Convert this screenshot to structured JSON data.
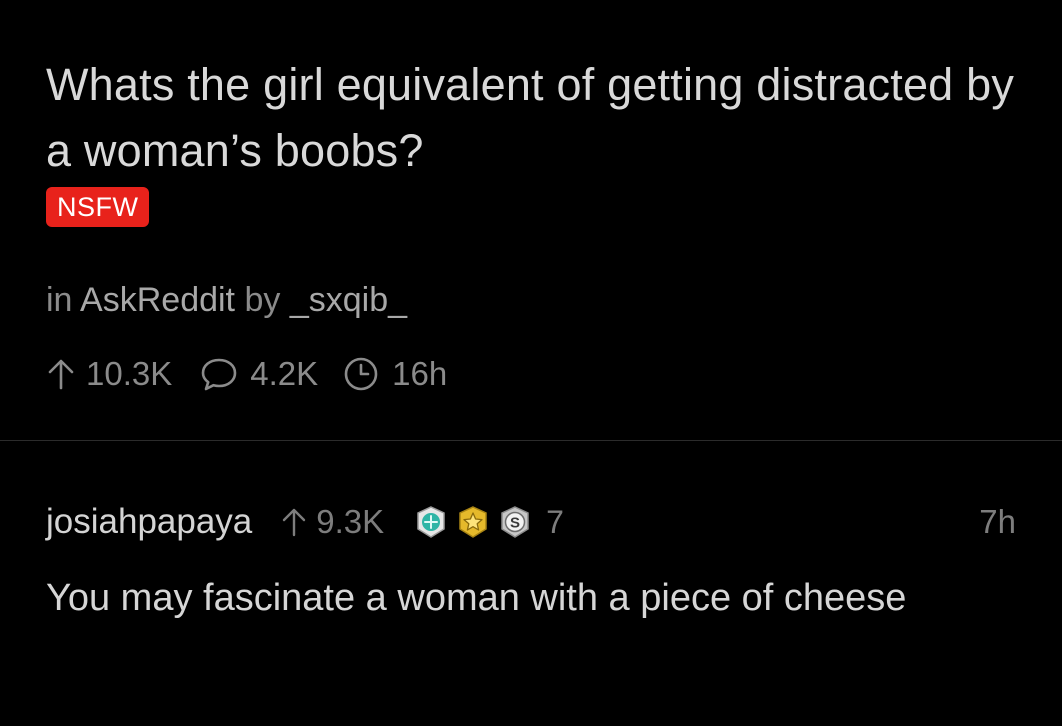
{
  "post": {
    "title": "Whats the girl equivalent of getting distracted by a woman’s boobs?",
    "nsfw_label": "NSFW",
    "meta": {
      "in_label": "in",
      "subreddit": "AskReddit",
      "by_label": "by",
      "author": "_sxqib_"
    },
    "stats": {
      "upvotes": "10.3K",
      "comments": "4.2K",
      "age": "16h"
    }
  },
  "comment": {
    "author": "josiahpapaya",
    "score": "9.3K",
    "awards": [
      {
        "name": "helpful-award-icon",
        "color": "#2fb5a6"
      },
      {
        "name": "wholesome-star-award-icon",
        "color": "#f3c530"
      },
      {
        "name": "silver-award-icon",
        "color": "#c7c7c7"
      }
    ],
    "award_count": "7",
    "age": "7h",
    "body": "You may fascinate a woman with a piece of cheese"
  },
  "colors": {
    "background": "#000000",
    "nsfw_badge": "#e8221b",
    "muted_text": "#8b8b8b",
    "divider": "#2b2b2b"
  }
}
